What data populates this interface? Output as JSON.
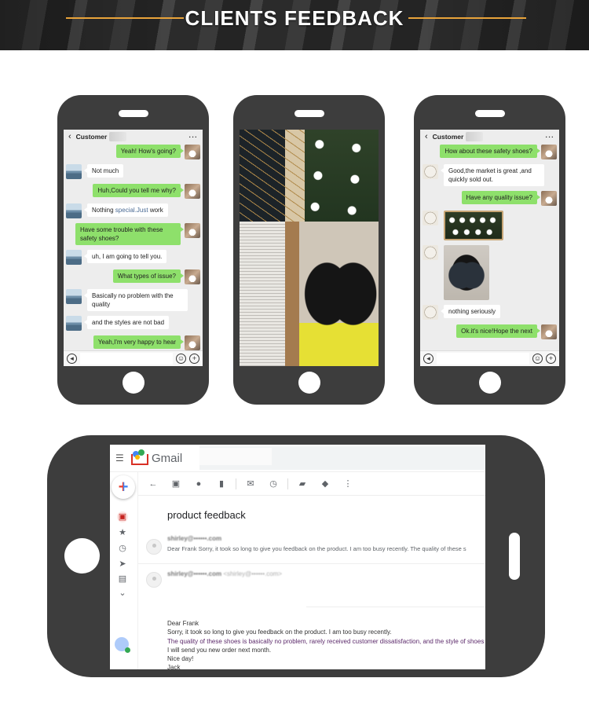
{
  "header": {
    "title": "CLIENTS FEEDBACK",
    "accent_color": "#e8a33a"
  },
  "phone1": {
    "contact_name": "Customer",
    "back_icon": "chevron-left-icon",
    "more_icon": "more-horizontal-icon",
    "messages": [
      {
        "side": "out",
        "text": "Yeah! How's going?"
      },
      {
        "side": "in",
        "text": "Not much"
      },
      {
        "side": "out",
        "text": "Huh,Could you tell me why?"
      },
      {
        "side": "in",
        "text_before": "Nothing ",
        "text_highlight": "special.Just",
        "text_after": " work"
      },
      {
        "side": "out",
        "text": "Have some trouble with these safety shoes?"
      },
      {
        "side": "in",
        "text": "uh, I am going to tell you."
      },
      {
        "side": "out",
        "text": "What types of issue?"
      },
      {
        "side": "in",
        "text": "Basically no problem with the quality"
      },
      {
        "side": "in",
        "text": "and the styles are not bad"
      },
      {
        "side": "out",
        "text": "Yeah,I'm very happy to hear"
      }
    ],
    "input_icons": [
      "voice-icon",
      "emoji-icon",
      "plus-icon"
    ]
  },
  "phone2": {
    "photos": [
      "laced-black-boot",
      "boxed-shoes-labels",
      "instruction-leaflet",
      "black-chelsea-boots"
    ]
  },
  "phone3": {
    "contact_name": "Customer",
    "messages": [
      {
        "side": "out",
        "type": "text",
        "text": "How about these safety shoes?"
      },
      {
        "side": "in",
        "type": "text",
        "text": "Good,the market is great ,and quickly sold out."
      },
      {
        "side": "out",
        "type": "text",
        "text": "Have any quality issue?"
      },
      {
        "side": "in",
        "type": "image",
        "image": "boxed-shoes-photo"
      },
      {
        "side": "in",
        "type": "image",
        "image": "boots-photo"
      },
      {
        "side": "in",
        "type": "text",
        "text": "nothing seriously"
      },
      {
        "side": "out",
        "type": "text",
        "text": "Ok.it's nice!Hope the next"
      }
    ]
  },
  "gmail": {
    "app_name": "Gmail",
    "toolbar": [
      "back-arrow-icon",
      "archive-icon",
      "report-spam-icon",
      "delete-icon",
      "mark-unread-icon",
      "snooze-icon",
      "move-to-icon",
      "label-icon",
      "more-vertical-icon"
    ],
    "sidebar": [
      "inbox-icon",
      "star-icon",
      "clock-icon",
      "send-icon",
      "draft-icon",
      "expand-more-icon"
    ],
    "subject": "product feedback",
    "thread": [
      {
        "sender": "shirley@••••••.com",
        "snippet": "Dear Frank Sorry, it took so long to give you feedback on the product. I am too busy recently. The quality of these s"
      },
      {
        "sender": "shirley@••••••.com",
        "sender_addr": "<shirley@••••••.com>"
      }
    ],
    "body": {
      "greeting": "Dear Frank",
      "line1": "Sorry, it took so long to give you feedback on the product. I am too busy recently.",
      "line2": "The quality of these shoes is basically no problem, rarely received customer dissatisfaction, and the style of shoes is v",
      "line3": "I will send you new order next month.",
      "line4": "Nice day!",
      "signature": "Jack"
    }
  }
}
